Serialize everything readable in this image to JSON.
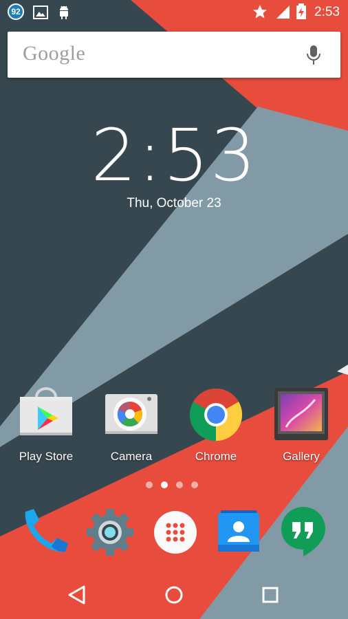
{
  "status_bar": {
    "notification_count": "92",
    "time": "2:53",
    "left_icons": [
      "notification-count-badge",
      "image-icon",
      "android-icon"
    ],
    "right_icons": [
      "star-icon",
      "signal-icon",
      "battery-charging-icon"
    ]
  },
  "search": {
    "logo": "Google",
    "mic_icon": "microphone-icon"
  },
  "clock": {
    "time": "2:53",
    "date": "Thu, October 23"
  },
  "apps": [
    {
      "label": "Play Store",
      "icon": "play-store-icon"
    },
    {
      "label": "Camera",
      "icon": "camera-icon"
    },
    {
      "label": "Chrome",
      "icon": "chrome-icon"
    },
    {
      "label": "Gallery",
      "icon": "gallery-icon"
    }
  ],
  "page_indicator": {
    "count": 4,
    "active": 1
  },
  "dock": [
    {
      "icon": "phone-icon"
    },
    {
      "icon": "settings-icon"
    },
    {
      "icon": "app-drawer-icon"
    },
    {
      "icon": "contacts-icon"
    },
    {
      "icon": "hangouts-icon"
    }
  ],
  "nav": [
    "back-icon",
    "home-icon",
    "recents-icon"
  ],
  "colors": {
    "red": "#e84c3d",
    "dark": "#37474f",
    "grey": "#819aa6"
  }
}
